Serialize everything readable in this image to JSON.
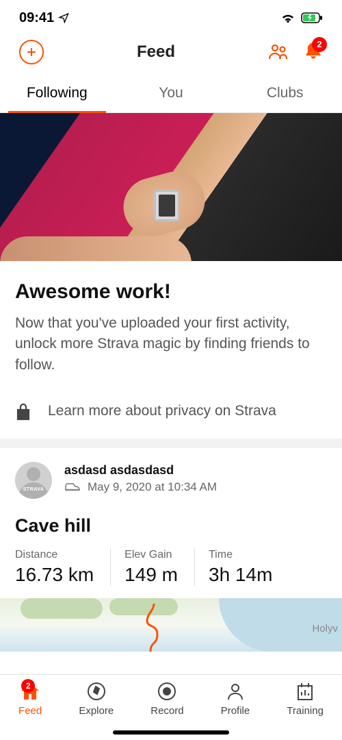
{
  "status": {
    "time": "09:41"
  },
  "header": {
    "title": "Feed",
    "notifications_count": "2"
  },
  "tabs": {
    "following": "Following",
    "you": "You",
    "clubs": "Clubs"
  },
  "hero": {
    "title": "Awesome work!",
    "text": "Now that you've uploaded your first activity, unlock more Strava magic by finding friends to follow."
  },
  "privacy": {
    "text": "Learn more about privacy on Strava"
  },
  "activity": {
    "user": "asdasd asdasdasd",
    "avatar_label": "STRAVA",
    "date": "May 9, 2020 at 10:34 AM",
    "title": "Cave hill",
    "stats": {
      "distance_label": "Distance",
      "distance_value": "16.73 km",
      "elev_label": "Elev Gain",
      "elev_value": "149 m",
      "time_label": "Time",
      "time_value": "3h 14m"
    },
    "map_label": "Holyv"
  },
  "nav": {
    "feed": "Feed",
    "feed_badge": "2",
    "explore": "Explore",
    "record": "Record",
    "profile": "Profile",
    "training": "Training"
  },
  "colors": {
    "accent": "#fc5200"
  }
}
